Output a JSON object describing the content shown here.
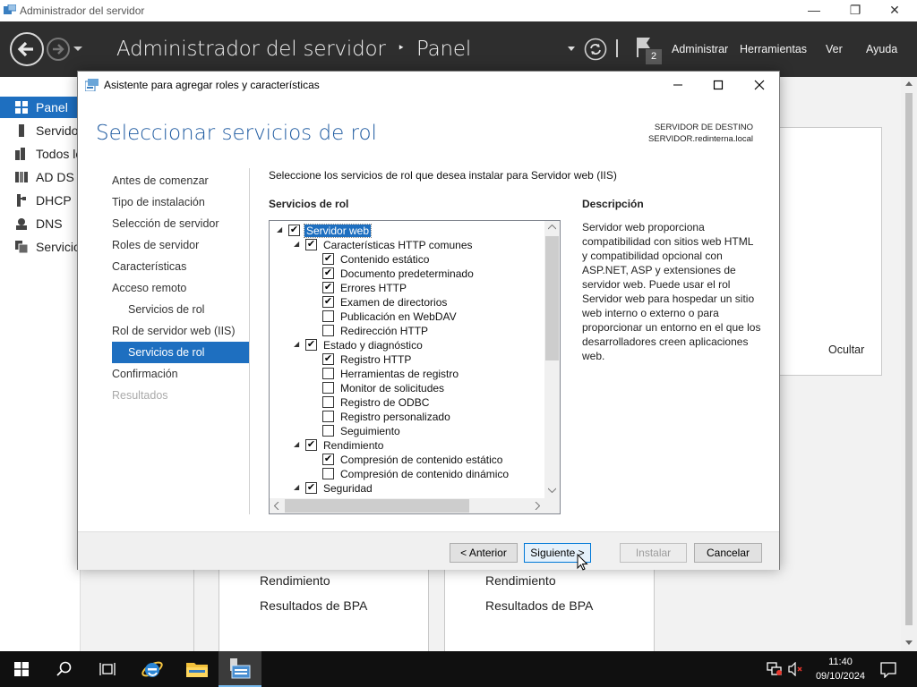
{
  "window": {
    "title": "Administrador del servidor",
    "minimize": "—",
    "maximize": "❐",
    "close": "✕"
  },
  "header": {
    "breadcrumb_root": "Administrador del servidor",
    "breadcrumb_sep": "‣",
    "breadcrumb_current": "Panel",
    "notification_count": "2",
    "menu": [
      "Administrar",
      "Herramientas",
      "Ver",
      "Ayuda"
    ]
  },
  "sidebar": {
    "items": [
      {
        "label": "Panel",
        "icon": "dashboard-icon",
        "selected": true
      },
      {
        "label": "Servidor local",
        "icon": "server-icon"
      },
      {
        "label": "Todos los servidores",
        "icon": "servers-icon"
      },
      {
        "label": "AD DS",
        "icon": "ad-ds-icon"
      },
      {
        "label": "DHCP",
        "icon": "dhcp-icon"
      },
      {
        "label": "DNS",
        "icon": "dns-icon"
      },
      {
        "label": "Servicios de archivos",
        "icon": "file-services-icon"
      }
    ]
  },
  "background": {
    "hide_label": "Ocultar",
    "tile1": [
      "Rendimiento",
      "Resultados de BPA"
    ],
    "tile2": [
      "Rendimiento",
      "Resultados de BPA"
    ]
  },
  "wizard": {
    "title": "Asistente para agregar roles y características",
    "heading": "Seleccionar servicios de rol",
    "dest_label": "SERVIDOR DE DESTINO",
    "dest_server": "SERVIDOR.redinterna.local",
    "steps": [
      {
        "label": "Antes de comenzar",
        "state": "normal"
      },
      {
        "label": "Tipo de instalación",
        "state": "normal"
      },
      {
        "label": "Selección de servidor",
        "state": "normal"
      },
      {
        "label": "Roles de servidor",
        "state": "normal"
      },
      {
        "label": "Características",
        "state": "normal"
      },
      {
        "label": "Acceso remoto",
        "state": "normal"
      },
      {
        "label": "Servicios de rol",
        "state": "sub"
      },
      {
        "label": "Rol de servidor web (IIS)",
        "state": "normal"
      },
      {
        "label": "Servicios de rol",
        "state": "selected"
      },
      {
        "label": "Confirmación",
        "state": "normal"
      },
      {
        "label": "Resultados",
        "state": "disabled"
      }
    ],
    "intro": "Seleccione los servicios de rol que desea instalar para Servidor web (IIS)",
    "roles_label": "Servicios de rol",
    "description_label": "Descripción",
    "description": "Servidor web proporciona compatibilidad con sitios web HTML y compatibilidad opcional con ASP.NET, ASP y extensiones de servidor web. Puede usar el rol Servidor web para hospedar un sitio web interno o externo o para proporcionar un entorno en el que los desarrolladores creen aplicaciones web.",
    "tree": [
      {
        "label": "Servidor web",
        "level": 0,
        "expander": true,
        "checked": true,
        "highlight": true
      },
      {
        "label": "Características HTTP comunes",
        "level": 1,
        "expander": true,
        "checked": true
      },
      {
        "label": "Contenido estático",
        "level": 2,
        "checked": true
      },
      {
        "label": "Documento predeterminado",
        "level": 2,
        "checked": true
      },
      {
        "label": "Errores HTTP",
        "level": 2,
        "checked": true
      },
      {
        "label": "Examen de directorios",
        "level": 2,
        "checked": true
      },
      {
        "label": "Publicación en WebDAV",
        "level": 2,
        "checked": false
      },
      {
        "label": "Redirección HTTP",
        "level": 2,
        "checked": false
      },
      {
        "label": "Estado y diagnóstico",
        "level": 1,
        "expander": true,
        "checked": true
      },
      {
        "label": "Registro HTTP",
        "level": 2,
        "checked": true
      },
      {
        "label": "Herramientas de registro",
        "level": 2,
        "checked": false
      },
      {
        "label": "Monitor de solicitudes",
        "level": 2,
        "checked": false
      },
      {
        "label": "Registro de ODBC",
        "level": 2,
        "checked": false
      },
      {
        "label": "Registro personalizado",
        "level": 2,
        "checked": false
      },
      {
        "label": "Seguimiento",
        "level": 2,
        "checked": false
      },
      {
        "label": "Rendimiento",
        "level": 1,
        "expander": true,
        "checked": true
      },
      {
        "label": "Compresión de contenido estático",
        "level": 2,
        "checked": true
      },
      {
        "label": "Compresión de contenido dinámico",
        "level": 2,
        "checked": false
      },
      {
        "label": "Seguridad",
        "level": 1,
        "expander": true,
        "checked": true
      }
    ],
    "buttons": {
      "previous": "< Anterior",
      "next": "Siguiente >",
      "install": "Instalar",
      "cancel": "Cancelar"
    }
  },
  "taskbar": {
    "time": "11:40",
    "date": "09/10/2024"
  },
  "colors": {
    "accent": "#1e6fc0",
    "header_bg": "#2e2e2e",
    "heading_blue": "#1e5aa0"
  }
}
